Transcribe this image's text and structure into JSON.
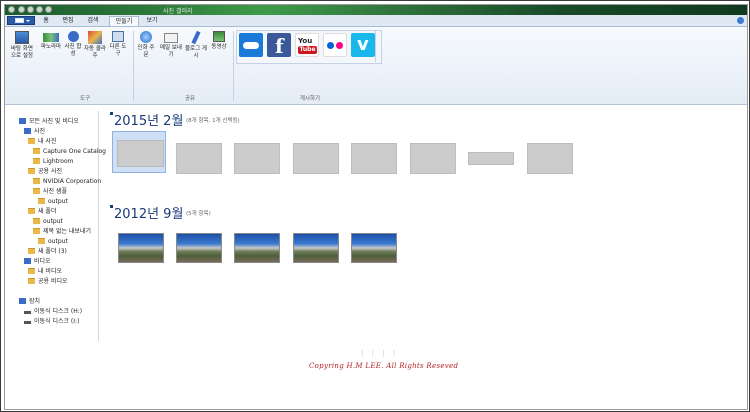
{
  "window": {
    "title": "사진 갤러리"
  },
  "tabs": [
    {
      "label": "홈"
    },
    {
      "label": "편집"
    },
    {
      "label": "검색"
    },
    {
      "label": "만들기"
    },
    {
      "label": "보기"
    }
  ],
  "ribbon": {
    "tools": {
      "desktop": "바탕 화면으로 설정",
      "panorama": "파노라마",
      "photo_fuse": "사진 합성",
      "auto_collage": "자동 콜라주",
      "other_tools": "다른 도구",
      "group_label": "도구"
    },
    "share": {
      "print_order": "인화 주문",
      "email": "메일 보내기",
      "blog_post": "블로그 게시",
      "movie": "동영상",
      "group_label": "공유"
    },
    "publish": {
      "group_label": "게시하기",
      "services": [
        "onedrive",
        "facebook",
        "youtube",
        "flickr",
        "vimeo"
      ],
      "youtube_you": "You",
      "youtube_tube": "Tube"
    }
  },
  "sidebar": {
    "items": [
      {
        "label": "모든 사진 및 비디오"
      },
      {
        "label": "사진"
      },
      {
        "label": "내 사진"
      },
      {
        "label": "Capture One Catalog"
      },
      {
        "label": "Lightroom"
      },
      {
        "label": "공용 사진"
      },
      {
        "label": "NVIDIA Corporation"
      },
      {
        "label": "사진 샘플"
      },
      {
        "label": "output"
      },
      {
        "label": "새 폴더"
      },
      {
        "label": "output"
      },
      {
        "label": "제목 없는 내보내기"
      },
      {
        "label": "output"
      },
      {
        "label": "새 폴더 (3)"
      },
      {
        "label": "비디오"
      },
      {
        "label": "내 비디오"
      },
      {
        "label": "공용 비디오"
      },
      {
        "label": "장치"
      },
      {
        "label": "이동식 디스크 (H:)"
      },
      {
        "label": "이동식 디스크 (I:)"
      }
    ]
  },
  "sections": [
    {
      "title": "2015년 2월",
      "subtitle": "(8개 항목, 1개 선택됨)"
    },
    {
      "title": "2012년 9월",
      "subtitle": "(5개 항목)"
    }
  ],
  "watermark": {
    "text": "Copyring H.M LEE. All Rights Reseved",
    "bars": "| | | |"
  },
  "colors": {
    "accent": "#1a3a7a",
    "watermark": "#b22222"
  }
}
